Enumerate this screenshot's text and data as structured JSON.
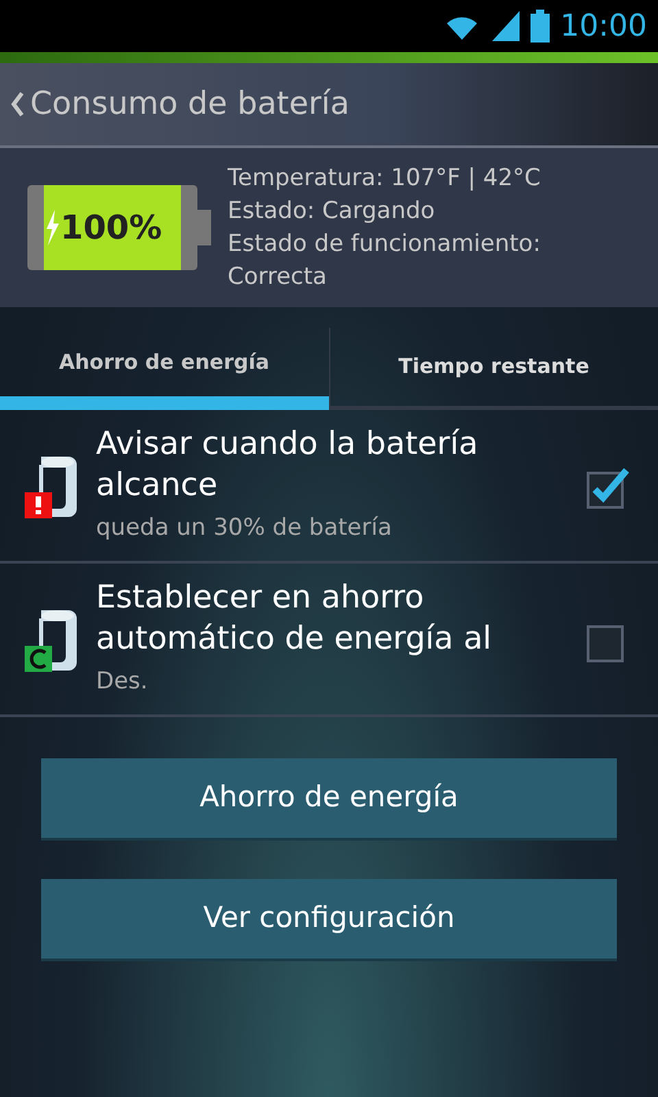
{
  "status_bar": {
    "time": "10:00"
  },
  "header": {
    "title": "Consumo de batería"
  },
  "battery": {
    "percent": "100%",
    "charging": true,
    "lines": [
      "Temperatura: 107°F | 42°C",
      "Estado: Cargando",
      "Estado de funcionamiento: Correcta"
    ]
  },
  "tabs": [
    {
      "label": "Ahorro de energía",
      "selected": true
    },
    {
      "label": "Tiempo restante",
      "selected": false
    }
  ],
  "settings": [
    {
      "kind": "alert",
      "title": "Avisar cuando la batería alcance",
      "summary": "queda un 30% de batería",
      "checked": true
    },
    {
      "kind": "auto",
      "title": "Establecer en ahorro automático de energía al",
      "summary": "Des.",
      "checked": false
    }
  ],
  "buttons": [
    "Ahorro de energía",
    "Ver configuración"
  ]
}
